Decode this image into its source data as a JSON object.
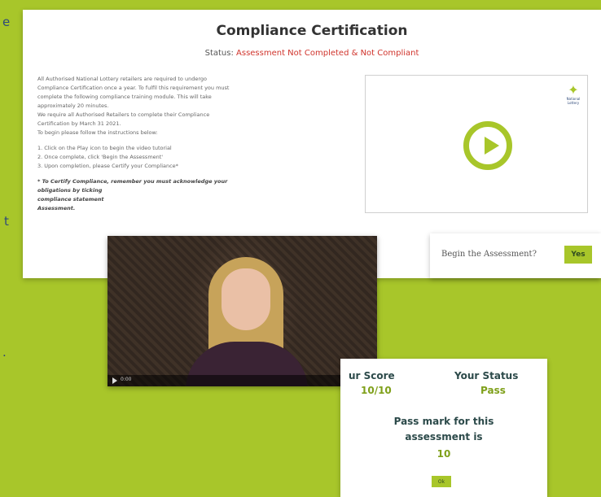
{
  "background_color": "#a8c62a",
  "edge_fragments": [
    "e",
    "t",
    "."
  ],
  "main": {
    "title": "Compliance Certification",
    "status_label": "Status:",
    "status_value": "Assessment Not Completed & Not Compliant",
    "status_color": "#d0342c",
    "body_lines": [
      "All Authorised National Lottery retailers are required to undergo",
      "Compliance Certification once a year. To fulfil this requirement you must",
      "complete the following compliance training module. This will take",
      "approximately 20 minutes.",
      "We require all Authorised Retailers to complete their Compliance",
      "Certification by March 31 2021.",
      "To begin please follow the instructions below:"
    ],
    "steps": [
      "1. Click on the Play icon to begin the video tutorial",
      "2. Once complete, click 'Begin the Assessment'",
      "3. Upon completion, please Certify your Compliance*"
    ],
    "footnote_lines": [
      "* To Certify Compliance, remember you must acknowledge your",
      "obligations by ticking",
      "compliance statement",
      "Assessment."
    ],
    "video_icon": "play-circle-icon",
    "logo_text": "National Lottery"
  },
  "begin": {
    "label": "Begin the Assessment?",
    "yes_label": "Yes"
  },
  "video_player": {
    "time": "0:00",
    "icons": "◐ ⛶"
  },
  "score": {
    "score_header": "ur Score",
    "score_value": "10/10",
    "status_header": "Your Status",
    "status_value": "Pass",
    "pass_mark_text": "Pass mark for this assessment is",
    "pass_mark_value": "10",
    "ok_label": "Ok"
  }
}
